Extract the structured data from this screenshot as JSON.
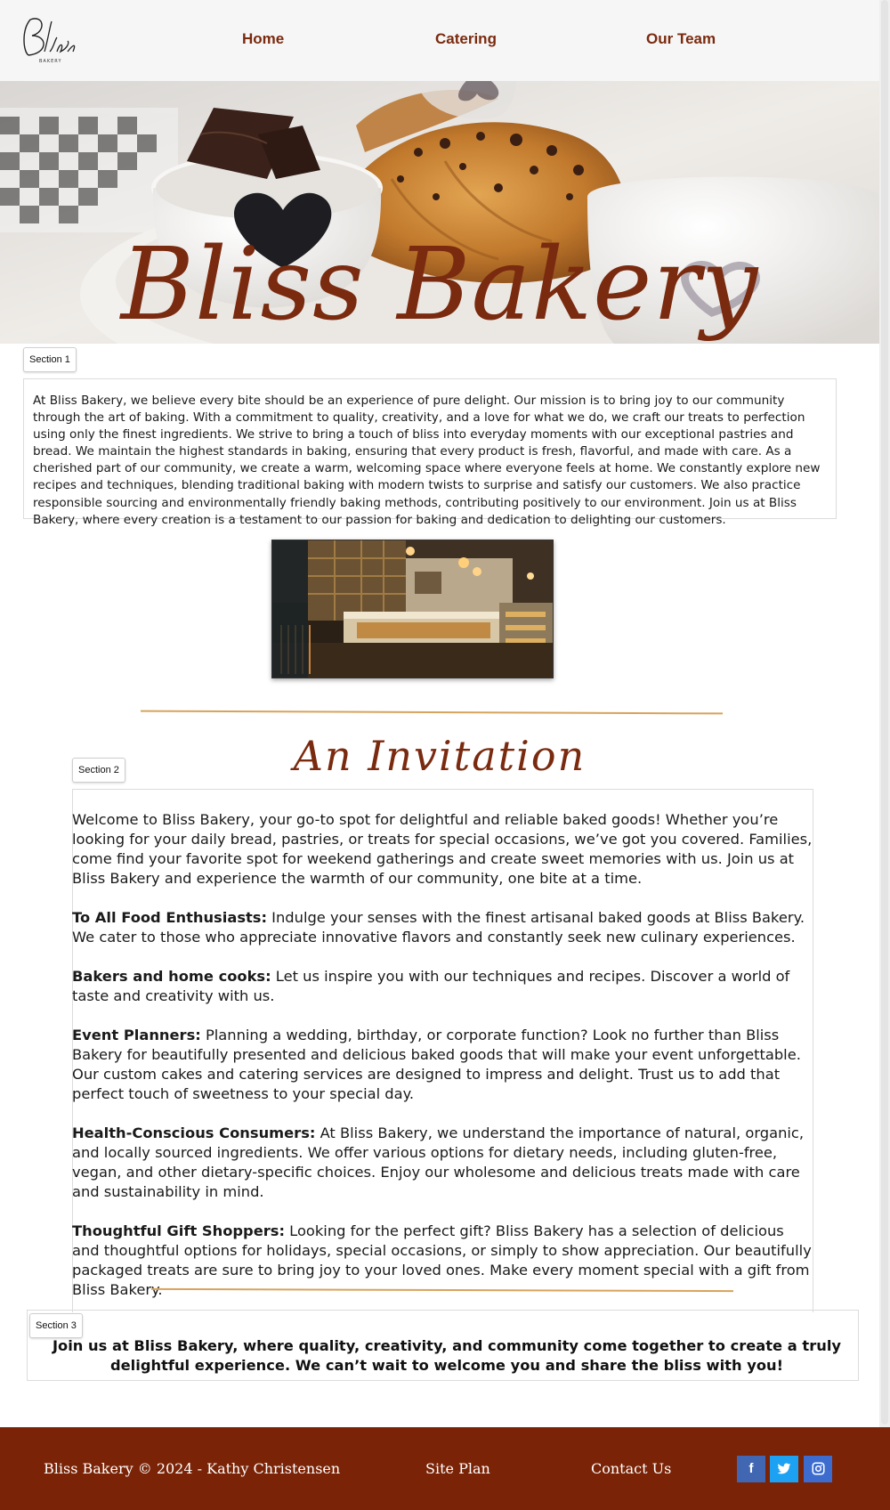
{
  "nav": {
    "logo_text": "Bliss",
    "logo_subtext": "BAKERY",
    "links": [
      "Home",
      "Catering",
      "Our Team"
    ]
  },
  "hero": {
    "title": "Bliss Bakery"
  },
  "sections": {
    "tag1": "Section 1",
    "tag2": "Section 2",
    "tag3": "Section 3"
  },
  "about": {
    "paragraph": "At Bliss Bakery, we believe every bite should be an experience of pure delight. Our mission is to bring joy to our community through the art of baking. With a commitment to quality, creativity, and a love for what we do, we craft our treats to perfection using only the finest ingredients. We strive to bring a touch of bliss into everyday moments with our exceptional pastries and bread. We maintain the highest standards in baking, ensuring that every product is fresh, flavorful, and made with care. As a cherished part of our community, we create a warm, welcoming space where everyone feels at home. We constantly explore new recipes and techniques, blending traditional baking with modern twists to surprise and satisfy our customers. We also practice responsible sourcing and environmentally friendly baking methods, contributing positively to our environment. Join us at Bliss Bakery, where every creation is a testament to our passion for baking and dedication to delighting our customers."
  },
  "invitation": {
    "heading": "An Invitation",
    "intro": "Welcome to Bliss Bakery, your go-to spot for delightful and reliable baked goods! Whether you’re looking for your daily bread, pastries, or treats for special occasions, we’ve got you covered. Families, come find your favorite spot for weekend gatherings and create sweet memories with us. Join us at Bliss Bakery and experience the warmth of our community, one bite at a time.",
    "groups": [
      {
        "label": "To All Food Enthusiasts:",
        "text": " Indulge your senses with the finest artisanal baked goods at Bliss Bakery. We cater to those who appreciate innovative flavors and constantly seek new culinary experiences."
      },
      {
        "label": "Bakers and home cooks:",
        "text": " Let us inspire you with our techniques and recipes. Discover a world of taste and creativity with us."
      },
      {
        "label": "Event Planners:",
        "text": " Planning a wedding, birthday, or corporate function? Look no further than Bliss Bakery for beautifully presented and delicious baked goods that will make your event unforgettable. Our custom cakes and catering services are designed to impress and delight. Trust us to add that perfect touch of sweetness to your special day."
      },
      {
        "label": "Health-Conscious Consumers:",
        "text": " At Bliss Bakery, we understand the importance of natural, organic, and locally sourced ingredients. We offer various options for dietary needs, including gluten-free, vegan, and other dietary-specific choices. Enjoy our wholesome and delicious treats made with care and sustainability in mind."
      },
      {
        "label": "Thoughtful Gift Shoppers:",
        "text": " Looking for the perfect gift? Bliss Bakery has a selection of delicious and thoughtful options for holidays, special occasions, or simply to show appreciation. Our beautifully packaged treats are sure to bring joy to your loved ones. Make every moment special with a gift from Bliss Bakery."
      }
    ]
  },
  "closing": {
    "text": "Join us at Bliss Bakery, where quality, creativity, and community come together to create a truly delightful experience. We can’t wait to welcome you and share the bliss with you!"
  },
  "footer": {
    "copyright": "Bliss Bakery © 2024 - Kathy Christensen",
    "site_plan": "Site Plan",
    "contact": "Contact Us",
    "social": [
      {
        "icon": "facebook-icon",
        "glyph": "f"
      },
      {
        "icon": "twitter-icon",
        "glyph": "🐦"
      },
      {
        "icon": "instagram-icon",
        "glyph": "◎"
      }
    ]
  },
  "colors": {
    "brand": "#7a2a0e",
    "footer": "#7a2306",
    "divider": "#d7a35c"
  }
}
